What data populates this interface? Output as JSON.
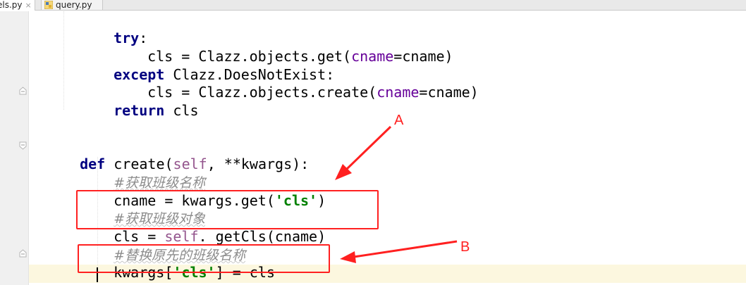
{
  "tabs": [
    {
      "label": "els.py",
      "close": "×"
    },
    {
      "label": "query.py"
    }
  ],
  "code": {
    "line1": {
      "kw": "try",
      "rest": ":"
    },
    "line2": {
      "a": "cls = Clazz.objects.get(",
      "param": "cname",
      "b": "=cname)"
    },
    "line3": {
      "kw": "except",
      "rest": " Clazz.DoesNotExist:"
    },
    "line4": {
      "a": "cls = Clazz.objects.create(",
      "param": "cname",
      "b": "=cname)"
    },
    "line5": {
      "kw": "return",
      "rest": " cls"
    },
    "line6": {
      "kw": "def",
      "name": " create(",
      "self": "self",
      "rest": ", **kwargs):"
    },
    "line7": {
      "comment": "#获取班级名称"
    },
    "line8": {
      "a": "cname = kwargs.get(",
      "str": "'cls'",
      "b": ")"
    },
    "line9": {
      "comment": "#获取班级对象"
    },
    "line10": {
      "a": "cls = ",
      "self": "self",
      "b": "._getCls(cname)"
    },
    "line11": {
      "comment": "#替换原先的班级名称"
    },
    "line12": {
      "a": "kwargs[",
      "str": "'cls'",
      "b": "] = cls"
    }
  },
  "annotations": {
    "a_label": "A",
    "b_label": "B",
    "color": "#ff2020"
  }
}
